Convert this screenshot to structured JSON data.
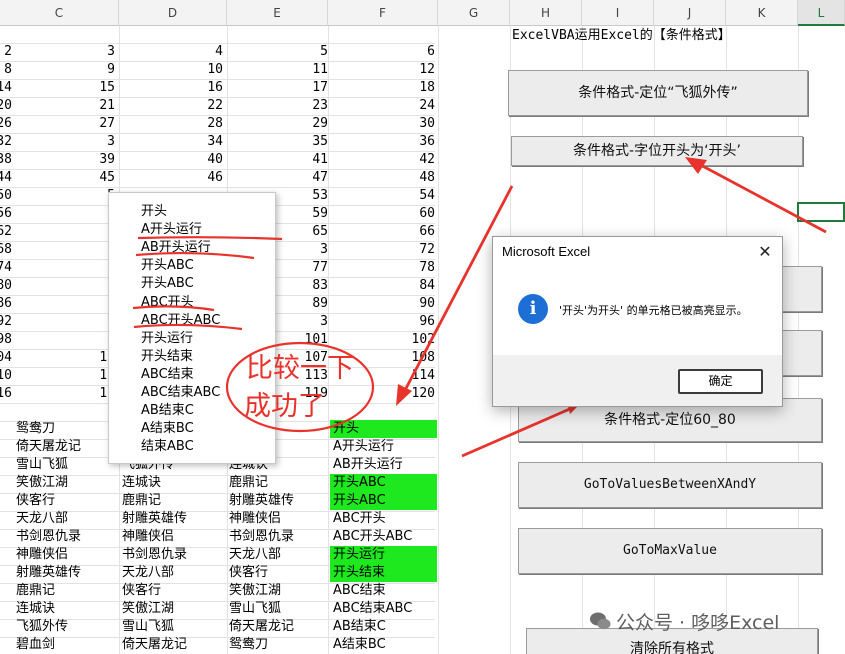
{
  "column_headers": [
    "C",
    "D",
    "E",
    "F",
    "G",
    "H",
    "I",
    "J",
    "K",
    "L"
  ],
  "selected_column": "L",
  "sheet_title": "ExcelVBA运用Excel的【条件格式】",
  "numeric_rows": [
    {
      "b": "2",
      "c": "3",
      "d": "4",
      "e": "5",
      "f": "6"
    },
    {
      "b": "8",
      "c": "9",
      "d": "10",
      "e": "11",
      "f": "12"
    },
    {
      "b": "14",
      "c": "15",
      "d": "16",
      "e": "17",
      "f": "18"
    },
    {
      "b": "20",
      "c": "21",
      "d": "22",
      "e": "23",
      "f": "24"
    },
    {
      "b": "26",
      "c": "27",
      "d": "28",
      "e": "29",
      "f": "30"
    },
    {
      "b": "32",
      "c": "3",
      "d": "34",
      "e": "35",
      "f": "36"
    },
    {
      "b": "38",
      "c": "39",
      "d": "40",
      "e": "41",
      "f": "42"
    },
    {
      "b": "44",
      "c": "45",
      "d": "46",
      "e": "47",
      "f": "48"
    },
    {
      "b": "50",
      "c": "5",
      "d": "",
      "e": "53",
      "f": "54"
    },
    {
      "b": "56",
      "c": "5",
      "d": "",
      "e": "59",
      "f": "60"
    },
    {
      "b": "62",
      "c": "6",
      "d": "",
      "e": "65",
      "f": "66"
    },
    {
      "b": "68",
      "c": "6",
      "d": "",
      "e": "3",
      "f": "72"
    },
    {
      "b": "74",
      "c": "",
      "d": "",
      "e": "77",
      "f": "78"
    },
    {
      "b": "80",
      "c": "8",
      "d": "",
      "e": "83",
      "f": "84"
    },
    {
      "b": "86",
      "c": "8",
      "d": "",
      "e": "89",
      "f": "90"
    },
    {
      "b": "92",
      "c": "9",
      "d": "",
      "e": "3",
      "f": "96"
    },
    {
      "b": "98",
      "c": "9",
      "d": "",
      "e": "101",
      "f": "102"
    },
    {
      "b": "104",
      "c": "10",
      "d": "",
      "e": "107",
      "f": "108"
    },
    {
      "b": "110",
      "c": "11",
      "d": "",
      "e": "113",
      "f": "114"
    },
    {
      "b": "116",
      "c": "11",
      "d": "",
      "e": "119",
      "f": "120"
    }
  ],
  "text_rows": [
    {
      "c": "鸳鸯刀",
      "d": "",
      "e": "",
      "f": "开头",
      "green": true
    },
    {
      "c": "倚天屠龙记",
      "d": "",
      "e": "传",
      "f": "A开头运行",
      "green": false
    },
    {
      "c": "雪山飞狐",
      "d": "飞狐外传",
      "e": "连城诀",
      "f": "AB开头运行",
      "green": false
    },
    {
      "c": "笑傲江湖",
      "d": "连城诀",
      "e": "鹿鼎记",
      "f": "开头ABC",
      "green": true
    },
    {
      "c": "侠客行",
      "d": "鹿鼎记",
      "e": "射雕英雄传",
      "f": "开头ABC",
      "green": true
    },
    {
      "c": "天龙八部",
      "d": "射雕英雄传",
      "e": "神雕侠侣",
      "f": "ABC开头",
      "green": false
    },
    {
      "c": "书剑恩仇录",
      "d": "神雕侠侣",
      "e": "书剑恩仇录",
      "f": "ABC开头ABC",
      "green": false
    },
    {
      "c": "神雕侠侣",
      "d": "书剑恩仇录",
      "e": "天龙八部",
      "f": "开头运行",
      "green": true
    },
    {
      "c": "射雕英雄传",
      "d": "天龙八部",
      "e": "侠客行",
      "f": "开头结束",
      "green": true
    },
    {
      "c": "鹿鼎记",
      "d": "侠客行",
      "e": "笑傲江湖",
      "f": "ABC结束",
      "green": false
    },
    {
      "c": "连城诀",
      "d": "笑傲江湖",
      "e": "雪山飞狐",
      "f": "ABC结束ABC",
      "green": false
    },
    {
      "c": "飞狐外传",
      "d": "雪山飞狐",
      "e": "倚天屠龙记",
      "f": "AB结束C",
      "green": false
    },
    {
      "c": "碧血剑",
      "d": "倚天屠龙记",
      "e": "鸳鸯刀",
      "f": "A结束BC",
      "green": false
    }
  ],
  "dropdown_items": [
    "开头",
    "A开头运行",
    "AB开头运行",
    "开头ABC",
    "开头ABC",
    "ABC开头",
    "ABC开头ABC",
    "开头运行",
    "开头结束",
    "ABC结束",
    "ABC结束ABC",
    "AB结束C",
    "A结束BC",
    "结束ABC"
  ],
  "buttons": {
    "locate_feihu": "条件格式-定位“飞狐外传”",
    "starts_with": "条件格式-字位开头为‘开头’",
    "locate_60_80": "条件格式-定位60_80",
    "between": "GoToValuesBetweenXAndY",
    "max_value": "GoToMaxValue",
    "clear_all": "清除所有格式"
  },
  "msgbox": {
    "title": "Microsoft Excel",
    "close_glyph": "✕",
    "icon_glyph": "i",
    "message": "'开头'为开头' 的单元格已被高亮显示。",
    "ok_label": "确定"
  },
  "annotation": {
    "line1": "比较一下",
    "line2": "成功了",
    "color": "#e8322c"
  },
  "watermark": "公众号 · 哆哆Excel",
  "colors": {
    "highlight_green": "#1ee81e",
    "selection_green": "#1f7a3c",
    "info_blue": "#1d6fd6"
  }
}
